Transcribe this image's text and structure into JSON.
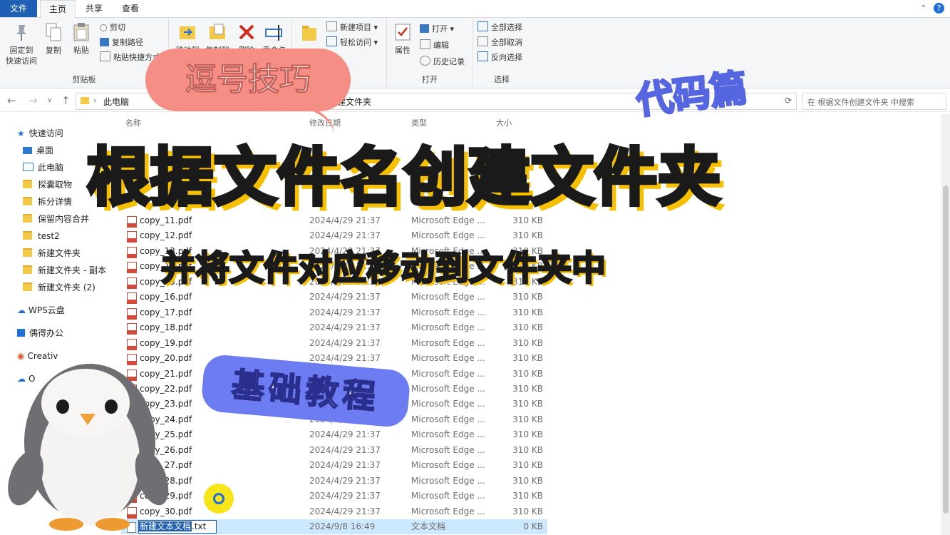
{
  "tabs": {
    "file": "文件",
    "home": "主页",
    "share": "共享",
    "view": "查看"
  },
  "window": {
    "help": "?",
    "collapse": "⌃"
  },
  "ribbon": {
    "clipboard": {
      "label": "剪贴板",
      "pin": "固定到\n快速访问",
      "copy": "复制",
      "paste": "粘贴",
      "cut": "剪切",
      "copy_path": "复制路径",
      "paste_shortcut": "粘贴快捷方式"
    },
    "organize": {
      "move": "移动到",
      "copy": "复制到",
      "delete": "删除",
      "rename": "重命名"
    },
    "new": {
      "new_item": "新建项目",
      "easy_access": "轻松访问"
    },
    "open": {
      "label": "打开",
      "properties": "属性",
      "open": "打开",
      "edit": "编辑",
      "history": "历史记录"
    },
    "select": {
      "label": "选择",
      "all": "全部选择",
      "none": "全部取消",
      "invert": "反向选择"
    }
  },
  "address": {
    "path": "此电脑  ›  桌面  ›  根据文件名创建文件夹",
    "path_start": "此电脑",
    "path_end": "文件名创建文件夹",
    "search_placeholder": "在 根据文件创建文件夹 中搜索"
  },
  "sidebar": {
    "items": [
      {
        "label": "快速访问"
      },
      {
        "label": "桌面"
      },
      {
        "label": "此电脑"
      },
      {
        "label": "探囊取物"
      },
      {
        "label": "拆分详情"
      },
      {
        "label": "保留内容合并"
      },
      {
        "label": "test2"
      },
      {
        "label": "新建文件夹"
      },
      {
        "label": "新建文件夹 - 副本"
      },
      {
        "label": "新建文件夹 (2)"
      },
      {
        "label": "WPS云盘"
      },
      {
        "label": "偶得办公"
      },
      {
        "label": "Creativ"
      },
      {
        "label": "O"
      }
    ]
  },
  "columns": {
    "name": "名称",
    "date": "修改日期",
    "type": "类型",
    "size": "大小"
  },
  "files": [
    {
      "name": "copy_11.pdf",
      "date": "2024/4/29 21:37",
      "type": "Microsoft Edge ...",
      "size": "310 KB"
    },
    {
      "name": "copy_12.pdf",
      "date": "2024/4/29 21:37",
      "type": "Microsoft Edge ...",
      "size": "310 KB"
    },
    {
      "name": "copy_13.pdf",
      "date": "2024/4/29 21:37",
      "type": "Microsoft Edge ...",
      "size": "310 KB"
    },
    {
      "name": "copy_14.pdf",
      "date": "2024/4/29 21:37",
      "type": "Microsoft Edge ...",
      "size": "310 KB"
    },
    {
      "name": "copy_15.pdf",
      "date": "2024/4/29 21:37",
      "type": "Microsoft Edge ...",
      "size": "310 KB"
    },
    {
      "name": "copy_16.pdf",
      "date": "2024/4/29 21:37",
      "type": "Microsoft Edge ...",
      "size": "310 KB"
    },
    {
      "name": "copy_17.pdf",
      "date": "2024/4/29 21:37",
      "type": "Microsoft Edge ...",
      "size": "310 KB"
    },
    {
      "name": "copy_18.pdf",
      "date": "2024/4/29 21:37",
      "type": "Microsoft Edge ...",
      "size": "310 KB"
    },
    {
      "name": "copy_19.pdf",
      "date": "2024/4/29 21:37",
      "type": "Microsoft Edge ...",
      "size": "310 KB"
    },
    {
      "name": "copy_20.pdf",
      "date": "2024/4/29 21:37",
      "type": "Microsoft Edge ...",
      "size": "310 KB"
    },
    {
      "name": "copy_21.pdf",
      "date": "2024/4/29 21:37",
      "type": "Microsoft Edge ...",
      "size": "310 KB"
    },
    {
      "name": "copy_22.pdf",
      "date": "2024/4/29 21:37",
      "type": "Microsoft Edge ...",
      "size": "310 KB"
    },
    {
      "name": "copy_23.pdf",
      "date": "2024/4/29 21:37",
      "type": "Microsoft Edge ...",
      "size": "310 KB"
    },
    {
      "name": "copy_24.pdf",
      "date": "2024/4/29 21:37",
      "type": "Microsoft Edge ...",
      "size": "310 KB"
    },
    {
      "name": "copy_25.pdf",
      "date": "2024/4/29 21:37",
      "type": "Microsoft Edge ...",
      "size": "310 KB"
    },
    {
      "name": "copy_26.pdf",
      "date": "2024/4/29 21:37",
      "type": "Microsoft Edge ...",
      "size": "310 KB"
    },
    {
      "name": "copy_27.pdf",
      "date": "2024/4/29 21:37",
      "type": "Microsoft Edge ...",
      "size": "310 KB"
    },
    {
      "name": "copy_28.pdf",
      "date": "2024/4/29 21:37",
      "type": "Microsoft Edge ...",
      "size": "310 KB"
    },
    {
      "name": "copy_29.pdf",
      "date": "2024/4/29 21:37",
      "type": "Microsoft Edge ...",
      "size": "310 KB"
    },
    {
      "name": "copy_30.pdf",
      "date": "2024/4/29 21:37",
      "type": "Microsoft Edge ...",
      "size": "310 KB"
    }
  ],
  "new_file": {
    "name_selected": "新建文本文档",
    "ext": ".txt",
    "date": "2024/9/8 16:49",
    "type": "文本文档",
    "size": "0 KB"
  },
  "overlay": {
    "tip_badge": "逗号技巧",
    "code_badge": "代码篇",
    "title": "根据文件名创建文件夹",
    "subtitle": "并将文件对应移动到文件夹中",
    "basic_badge": "基础教程"
  },
  "colors": {
    "accent": "#1f5fb4",
    "title_fill": "#ffe533",
    "title_shadow": "#f6c000",
    "badge_pink": "#f58f86",
    "badge_blue": "#6d7df1"
  }
}
